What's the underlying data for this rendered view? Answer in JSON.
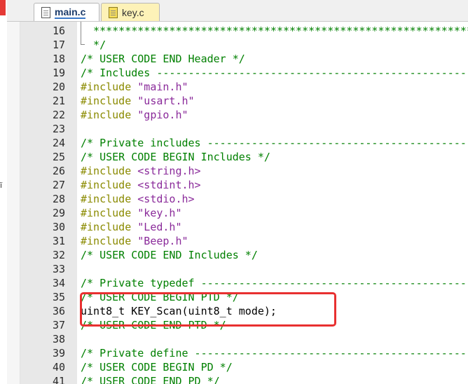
{
  "left_panel": {
    "glyph": "ï"
  },
  "tabs": [
    {
      "label": "main.c",
      "active": true
    },
    {
      "label": "key.c",
      "active": false
    }
  ],
  "highlight_color": "#e83030",
  "lines": [
    {
      "n": "16",
      "parts": [
        {
          "t": "  ****************************************************************************",
          "c": "cm"
        }
      ]
    },
    {
      "n": "17",
      "parts": [
        {
          "t": "  */",
          "c": "cm"
        }
      ]
    },
    {
      "n": "18",
      "parts": [
        {
          "t": "/* USER CODE END Header */",
          "c": "cm"
        }
      ]
    },
    {
      "n": "19",
      "parts": [
        {
          "t": "/* Includes ------------------------------------------------------------------",
          "c": "cm"
        }
      ]
    },
    {
      "n": "20",
      "parts": [
        {
          "t": "#include ",
          "c": "pp"
        },
        {
          "t": "\"main.h\"",
          "c": "str"
        }
      ]
    },
    {
      "n": "21",
      "parts": [
        {
          "t": "#include ",
          "c": "pp"
        },
        {
          "t": "\"usart.h\"",
          "c": "str"
        }
      ]
    },
    {
      "n": "22",
      "parts": [
        {
          "t": "#include ",
          "c": "pp"
        },
        {
          "t": "\"gpio.h\"",
          "c": "str"
        }
      ]
    },
    {
      "n": "23",
      "parts": []
    },
    {
      "n": "24",
      "parts": [
        {
          "t": "/* Private includes ----------------------------------------------------------",
          "c": "cm"
        }
      ]
    },
    {
      "n": "25",
      "parts": [
        {
          "t": "/* USER CODE BEGIN Includes */",
          "c": "cm"
        }
      ]
    },
    {
      "n": "26",
      "parts": [
        {
          "t": "#include ",
          "c": "pp"
        },
        {
          "t": "<string.h>",
          "c": "str"
        }
      ]
    },
    {
      "n": "27",
      "parts": [
        {
          "t": "#include ",
          "c": "pp"
        },
        {
          "t": "<stdint.h>",
          "c": "str"
        }
      ]
    },
    {
      "n": "28",
      "parts": [
        {
          "t": "#include ",
          "c": "pp"
        },
        {
          "t": "<stdio.h>",
          "c": "str"
        }
      ]
    },
    {
      "n": "29",
      "parts": [
        {
          "t": "#include ",
          "c": "pp"
        },
        {
          "t": "\"key.h\"",
          "c": "str"
        }
      ]
    },
    {
      "n": "30",
      "parts": [
        {
          "t": "#include ",
          "c": "pp"
        },
        {
          "t": "\"Led.h\"",
          "c": "str"
        }
      ]
    },
    {
      "n": "31",
      "parts": [
        {
          "t": "#include ",
          "c": "pp"
        },
        {
          "t": "\"Beep.h\"",
          "c": "str"
        }
      ]
    },
    {
      "n": "32",
      "parts": [
        {
          "t": "/* USER CODE END Includes */",
          "c": "cm"
        }
      ]
    },
    {
      "n": "33",
      "parts": []
    },
    {
      "n": "34",
      "parts": [
        {
          "t": "/* Private typedef -----------------------------------------------------------",
          "c": "cm"
        }
      ]
    },
    {
      "n": "35",
      "parts": [
        {
          "t": "/* USER CODE BEGIN PTD */",
          "c": "cm"
        }
      ]
    },
    {
      "n": "36",
      "parts": [
        {
          "t": "uint8_t KEY_Scan(uint8_t mode);",
          "c": "plain"
        }
      ]
    },
    {
      "n": "37",
      "parts": [
        {
          "t": "/* USER CODE END PTD */",
          "c": "cm"
        }
      ]
    },
    {
      "n": "38",
      "parts": []
    },
    {
      "n": "39",
      "parts": [
        {
          "t": "/* Private define ------------------------------------------------------------",
          "c": "cm"
        }
      ]
    },
    {
      "n": "40",
      "parts": [
        {
          "t": "/* USER CODE BEGIN PD */",
          "c": "cm"
        }
      ]
    },
    {
      "n": "41",
      "parts": [
        {
          "t": "/* USER CODE END PD */",
          "c": "cm"
        }
      ]
    }
  ]
}
